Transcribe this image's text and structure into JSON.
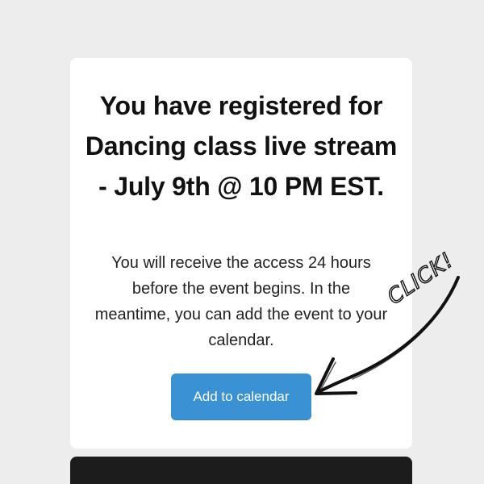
{
  "card": {
    "title": "You have registered for Dancing class live stream - July 9th @ 10 PM EST.",
    "body": "You will receive the access 24 hours before the event begins. In the meantime, you can add the event to your calendar.",
    "button_label": "Add to calendar"
  },
  "annotation": {
    "text": "CLICK!",
    "icon": "hand-drawn-arrow-icon"
  },
  "colors": {
    "page_background": "#ededed",
    "card_background": "#ffffff",
    "button_background": "#3a91d3",
    "button_text": "#ffffff",
    "dark_panel": "#1c1c1c"
  }
}
